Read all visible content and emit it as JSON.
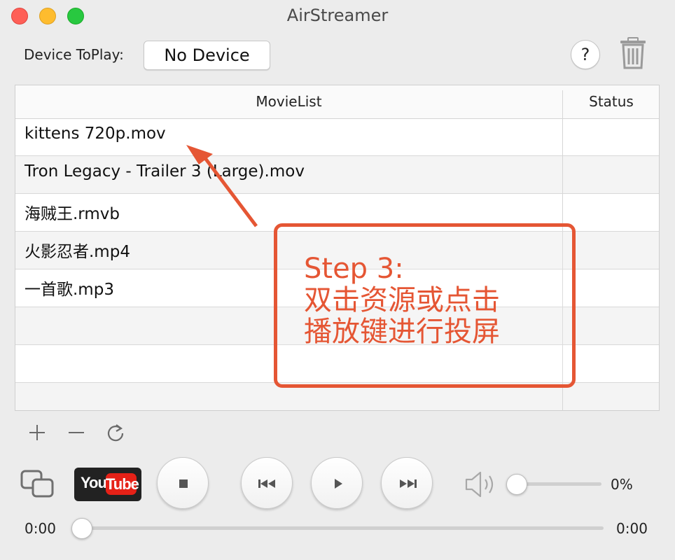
{
  "window": {
    "title": "AirStreamer"
  },
  "device": {
    "label": "Device ToPlay:",
    "selected": "No Device",
    "help_label": "?"
  },
  "table": {
    "columns": [
      "MovieList",
      "Status"
    ],
    "rows": [
      {
        "name": "kittens 720p.mov",
        "status": ""
      },
      {
        "name": "Tron Legacy - Trailer 3 (Large).mov",
        "status": ""
      },
      {
        "name": "海贼王.rmvb",
        "status": ""
      },
      {
        "name": "火影忍者.mp4",
        "status": ""
      },
      {
        "name": "一首歌.mp3",
        "status": ""
      },
      {
        "name": "",
        "status": ""
      },
      {
        "name": "",
        "status": ""
      },
      {
        "name": "",
        "status": ""
      }
    ]
  },
  "toolbar": {
    "add_icon": "plus-icon",
    "remove_icon": "minus-icon",
    "refresh_icon": "refresh-icon"
  },
  "player": {
    "youtube_you": "You",
    "youtube_tube": "Tube",
    "volume": {
      "percent_label": "0%",
      "value": 0
    },
    "progress": {
      "current": "0:00",
      "total": "0:00",
      "value": 0
    }
  },
  "annotation": {
    "step": "Step 3:",
    "line1": "双击资源或点击",
    "line2": "播放键进行投屏",
    "color": "#e55634"
  }
}
